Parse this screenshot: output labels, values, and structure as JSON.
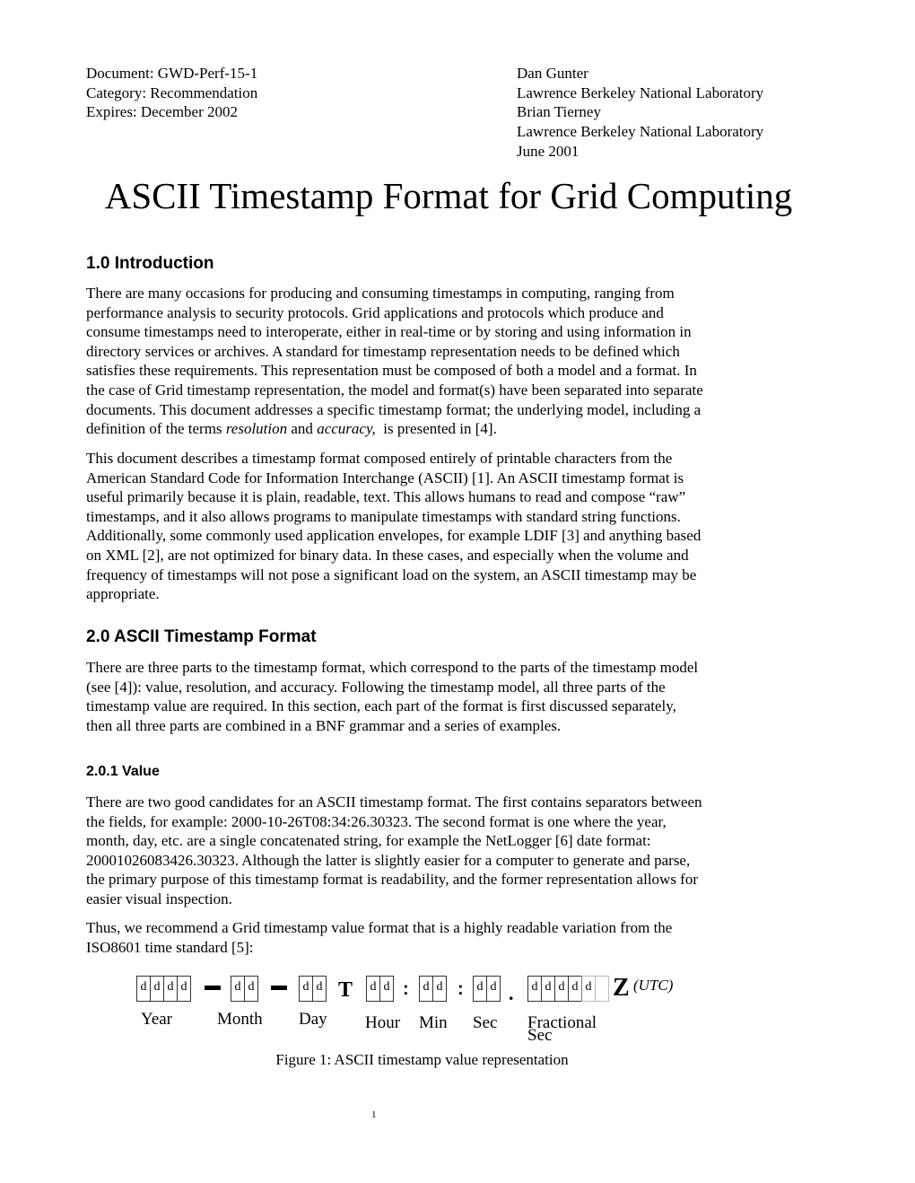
{
  "header": {
    "left": [
      "Document: GWD-Perf-15-1",
      "Category: Recommendation",
      "Expires: December 2002"
    ],
    "right": [
      "Dan Gunter",
      "Lawrence Berkeley National Laboratory",
      "Brian Tierney",
      "Lawrence Berkeley National Laboratory",
      "June 2001"
    ]
  },
  "title": "ASCII Timestamp Format for Grid Computing",
  "sections": {
    "intro": {
      "heading": "1.0  Introduction",
      "p1": [
        "There are many occasions for producing and consuming timestamps in computing, ranging from",
        "performance analysis to security protocols.  Grid applications and protocols which produce and",
        "consume timestamps need to interoperate, either in real-time or by storing and using information in",
        "directory services or archives. A standard for timestamp representation needs to be defined which",
        "satisfies these requirements. This representation must be composed of both a model and a format. In",
        "the case of Grid timestamp representation, the model and format(s) have been separated into separate",
        "documents. This document addresses a specific timestamp format; the underlying model, including a"
      ],
      "p1_last": {
        "before": "definition of the terms ",
        "em1": "resolution",
        "mid": " and ",
        "em2": "accuracy,",
        "after": "  is presented in [4]."
      },
      "p2": [
        "This document describes a timestamp format composed entirely of printable characters from the",
        "American Standard Code for Information Interchange (ASCII) [1]. An ASCII timestamp format is",
        "useful primarily because it is plain, readable, text. This allows humans to read and compose “raw”",
        "timestamps, and it also allows programs to manipulate timestamps with standard string functions.",
        "Additionally, some commonly used application envelopes, for example LDIF [3] and anything based",
        "on XML [2], are not optimized for binary data. In these cases, and especially when the volume and",
        "frequency of timestamps will not pose a significant load on the system, an ASCII timestamp may be",
        "appropriate."
      ]
    },
    "format": {
      "heading": "2.0  ASCII Timestamp Format",
      "p1": [
        "There are three parts to the timestamp format, which correspond to the parts of the timestamp model",
        "(see [4]): value, resolution, and accuracy. Following the timestamp model, all three parts of the",
        "timestamp value are required. In this section, each part of the format is first discussed separately,",
        "then all three parts are combined in a BNF grammar and a series of examples."
      ]
    },
    "value": {
      "heading": "2.0.1  Value",
      "p1": [
        "There are two good candidates for an ASCII timestamp format. The first contains separators between",
        "the fields, for example: 2000-10-26T08:34:26.30323. The second format is one where the year,",
        "month, day, etc. are a single concatenated string, for example the NetLogger [6] date format:",
        "20001026083426.30323. Although the latter is slightly easier for a computer to generate and parse,",
        "the primary purpose of this timestamp format is readability, and the former representation allows for",
        "easier visual inspection."
      ],
      "p2": [
        "Thus, we recommend a Grid timestamp value format that is a highly readable variation from the",
        "ISO8601 time standard [5]:"
      ]
    }
  },
  "figure": {
    "digit": "d",
    "separators": {
      "T": "T",
      "colon": ":",
      "dot": ".",
      "Z": "Z"
    },
    "utc": "(UTC)",
    "labels": {
      "year": "Year",
      "month": "Month",
      "day": "Day",
      "hour": "Hour",
      "min": "Min",
      "sec": "Sec",
      "frac1": "Fractional",
      "frac2": "Sec"
    },
    "caption": "Figure 1:  ASCII timestamp value representation"
  },
  "page_number": "1"
}
